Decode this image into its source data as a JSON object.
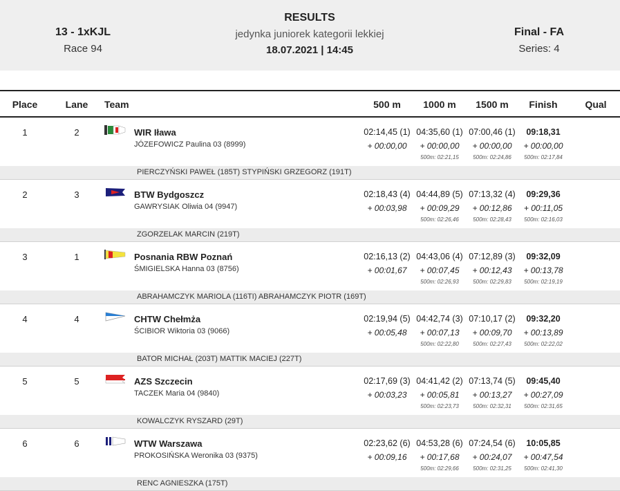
{
  "header": {
    "event_code": "13 - 1xKJL",
    "race": "Race 94",
    "title": "RESULTS",
    "subtitle": "jedynka juniorek kategorii lekkiej",
    "date_time": "18.07.2021 | 14:45",
    "final": "Final - FA",
    "series": "Series: 4"
  },
  "columns": {
    "place": "Place",
    "lane": "Lane",
    "team": "Team",
    "m500": "500 m",
    "m1000": "1000 m",
    "m1500": "1500 m",
    "finish": "Finish",
    "qual": "Qual"
  },
  "rows": [
    {
      "place": "1",
      "lane": "2",
      "team": "WIR Iława",
      "rower": "JÓZEFOWICZ  Paulina 03 (8999)",
      "flag_icon": "flag-green-white-red",
      "s500": "02:14,45 (1)",
      "s1000": "04:35,60 (1)",
      "s1500": "07:00,46 (1)",
      "finish": "09:18,31",
      "d500": "+ 00:00,00",
      "d1000": "+ 00:00,00",
      "d1500": "+ 00:00,00",
      "dfin": "+ 00:00,00",
      "p1000": "500m: 02:21,15",
      "p1500": "500m: 02:24,86",
      "pfin": "500m: 02:17,84",
      "coach": "PIERCZYŃSKI PAWEŁ (185T) STYPIŃSKI GRZEGORZ (191T)"
    },
    {
      "place": "2",
      "lane": "3",
      "team": "BTW Bydgoszcz",
      "rower": "GAWRYSIAK  Oliwia 04 (9947)",
      "flag_icon": "flag-navy-red",
      "s500": "02:18,43 (4)",
      "s1000": "04:44,89 (5)",
      "s1500": "07:13,32 (4)",
      "finish": "09:29,36",
      "d500": "+ 00:03,98",
      "d1000": "+ 00:09,29",
      "d1500": "+ 00:12,86",
      "dfin": "+ 00:11,05",
      "p1000": "500m: 02:26,46",
      "p1500": "500m: 02:28,43",
      "pfin": "500m: 02:16,03",
      "coach": "ZGORZELAK MARCIN (219T)"
    },
    {
      "place": "3",
      "lane": "1",
      "team": "Posnania RBW Poznań",
      "rower": "ŚMIGIELSKA  Hanna 03 (8756)",
      "flag_icon": "flag-yellow-red",
      "s500": "02:16,13 (2)",
      "s1000": "04:43,06 (4)",
      "s1500": "07:12,89 (3)",
      "finish": "09:32,09",
      "d500": "+ 00:01,67",
      "d1000": "+ 00:07,45",
      "d1500": "+ 00:12,43",
      "dfin": "+ 00:13,78",
      "p1000": "500m: 02:26,93",
      "p1500": "500m: 02:29,83",
      "pfin": "500m: 02:19,19",
      "coach": "ABRAHAMCZYK MARIOLA (116TI) ABRAHAMCZYK PIOTR (169T)"
    },
    {
      "place": "4",
      "lane": "4",
      "team": "CHTW Chełmża",
      "rower": "ŚCIBIOR  Wiktoria 03 (9066)",
      "flag_icon": "flag-blue-white",
      "s500": "02:19,94 (5)",
      "s1000": "04:42,74 (3)",
      "s1500": "07:10,17 (2)",
      "finish": "09:32,20",
      "d500": "+ 00:05,48",
      "d1000": "+ 00:07,13",
      "d1500": "+ 00:09,70",
      "dfin": "+ 00:13,89",
      "p1000": "500m: 02:22,80",
      "p1500": "500m: 02:27,43",
      "pfin": "500m: 02:22,02",
      "coach": "BATOR MICHAŁ (203T) MATTIK MACIEJ (227T)"
    },
    {
      "place": "5",
      "lane": "5",
      "team": "AZS Szczecin",
      "rower": "TACZEK  Maria 04 (9840)",
      "flag_icon": "flag-red-white",
      "s500": "02:17,69 (3)",
      "s1000": "04:41,42 (2)",
      "s1500": "07:13,74 (5)",
      "finish": "09:45,40",
      "d500": "+ 00:03,23",
      "d1000": "+ 00:05,81",
      "d1500": "+ 00:13,27",
      "dfin": "+ 00:27,09",
      "p1000": "500m: 02:23,73",
      "p1500": "500m: 02:32,31",
      "pfin": "500m: 02:31,65",
      "coach": "KOWALCZYK RYSZARD (29T)"
    },
    {
      "place": "6",
      "lane": "6",
      "team": "WTW Warszawa",
      "rower": "PROKOSIŃSKA  Weronika 03 (9375)",
      "flag_icon": "flag-navy-white",
      "s500": "02:23,62 (6)",
      "s1000": "04:53,28 (6)",
      "s1500": "07:24,54 (6)",
      "finish": "10:05,85",
      "d500": "+ 00:09,16",
      "d1000": "+ 00:17,68",
      "d1500": "+ 00:24,07",
      "dfin": "+ 00:47,54",
      "p1000": "500m: 02:29,66",
      "p1500": "500m: 02:31,25",
      "pfin": "500m: 02:41,30",
      "coach": "RENC AGNIESZKA (175T)"
    }
  ]
}
